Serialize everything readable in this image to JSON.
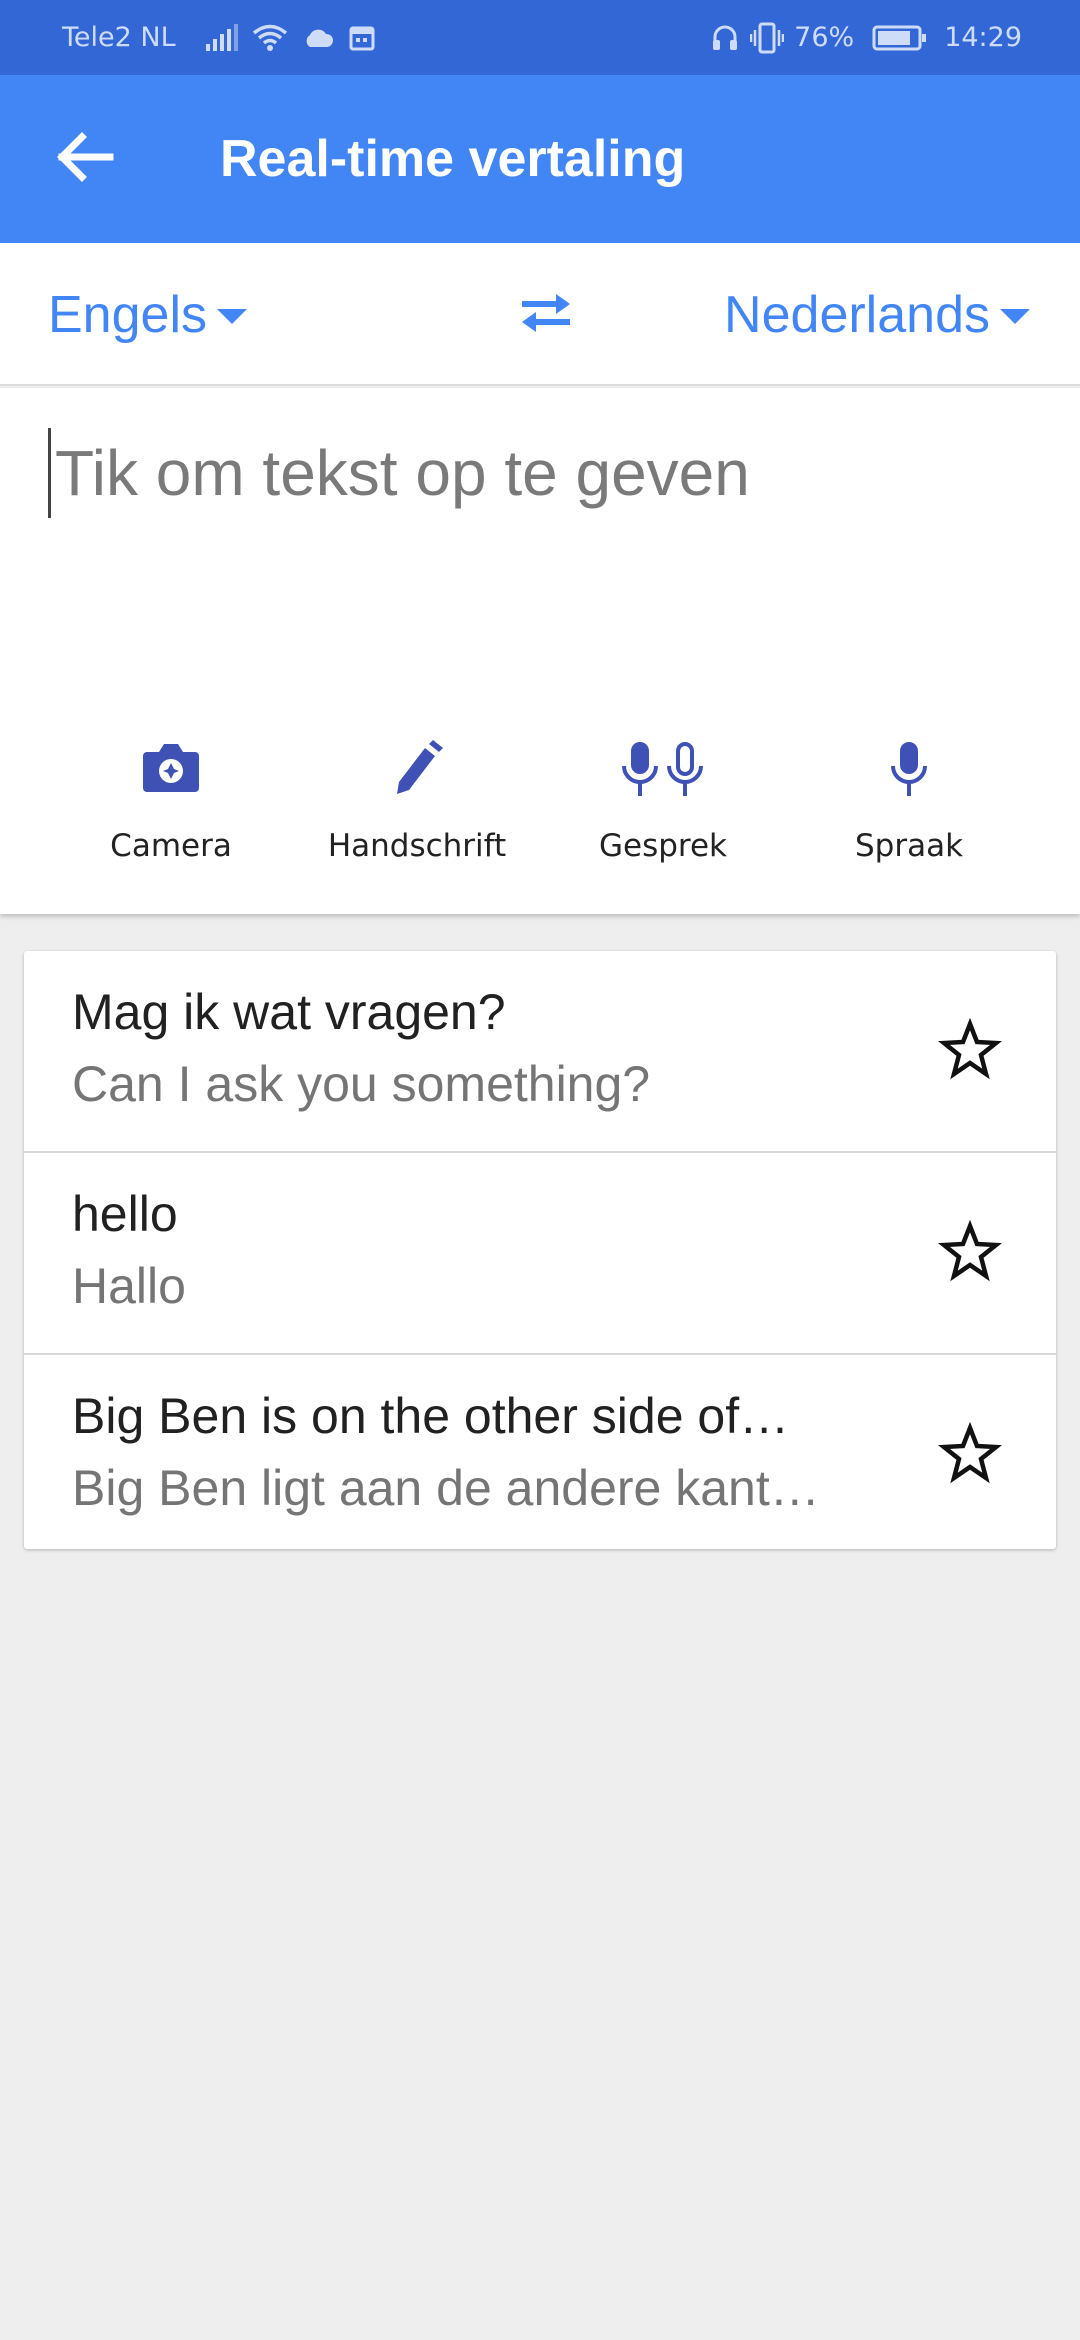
{
  "status_bar": {
    "carrier": "Tele2 NL",
    "battery": "76%",
    "time": "14:29",
    "icons": [
      "signal-icon",
      "wifi-icon",
      "cloud-icon",
      "calendar-icon",
      "headset-icon",
      "vibrate-icon",
      "battery-icon"
    ]
  },
  "app_bar": {
    "title": "Real-time vertaling",
    "back_icon": "arrow-back-icon"
  },
  "languages": {
    "source": "Engels",
    "target": "Nederlands",
    "swap_icon": "swap-horiz-icon"
  },
  "input": {
    "placeholder": "Tik om tekst op te geven"
  },
  "tools": [
    {
      "label": "Camera",
      "icon": "camera-icon"
    },
    {
      "label": "Handschrift",
      "icon": "pen-icon"
    },
    {
      "label": "Gesprek",
      "icon": "two-mics-icon"
    },
    {
      "label": "Spraak",
      "icon": "mic-icon"
    }
  ],
  "history": [
    {
      "original": "Mag ik wat vragen?",
      "translation": "Can I ask you something?"
    },
    {
      "original": "hello",
      "translation": "Hallo"
    },
    {
      "original": "Big Ben is on the other side of…",
      "translation": "Big Ben ligt aan de andere kant…"
    }
  ],
  "colors": {
    "status_bar": "#3367d6",
    "app_bar": "#4285f4",
    "accent": "#4285f4",
    "tool_icon": "#3f51b5",
    "background": "#eeeeee"
  }
}
